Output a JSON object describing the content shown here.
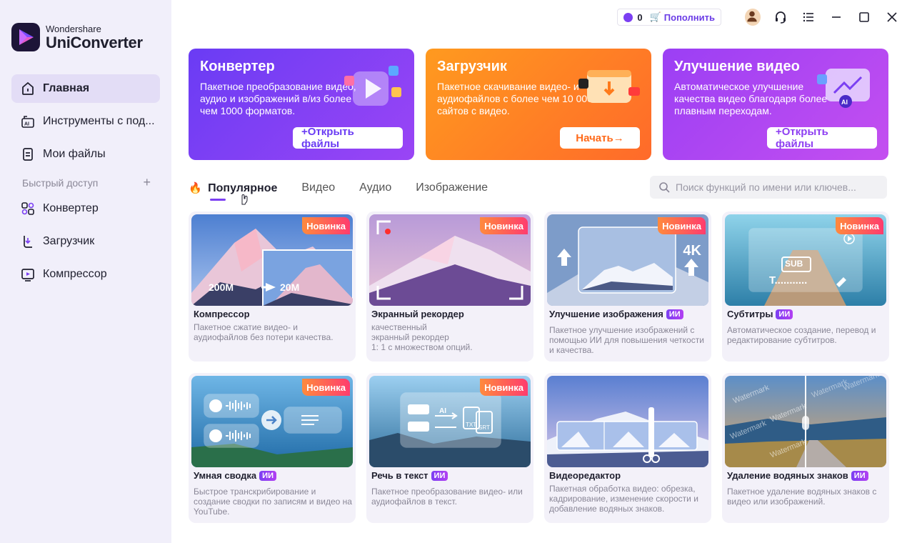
{
  "brand": {
    "company": "Wondershare",
    "product": "UniConverter"
  },
  "sidebar": {
    "items": [
      {
        "label": "Главная",
        "icon": "home-icon"
      },
      {
        "label": "Инструменты с под...",
        "icon": "ai-tools-icon"
      },
      {
        "label": "Мои файлы",
        "icon": "files-icon"
      }
    ],
    "quick_access_label": "Быстрый доступ",
    "quick_add": "+",
    "quick_items": [
      {
        "label": "Конвертер",
        "icon": "converter-icon"
      },
      {
        "label": "Загрузчик",
        "icon": "downloader-icon"
      },
      {
        "label": "Компрессор",
        "icon": "compressor-icon"
      }
    ]
  },
  "topbar": {
    "credits": "0",
    "topup_label": "Пополнить"
  },
  "banners": [
    {
      "title": "Конвертер",
      "desc": "Пакетное преобразование видео, аудио и изображений в/из более чем 1000 форматов.",
      "button": "+Открыть файлы",
      "color": "#7a3ff0"
    },
    {
      "title": "Загрузчик",
      "desc": "Пакетное скачивание видео- и аудиофайлов с более чем 10 000 сайтов с видео.",
      "button": "Начать→",
      "color": "#ff8a1f"
    },
    {
      "title": "Улучшение видео",
      "desc": "Автоматическое улучшение качества видео благодаря более плавным переходам.",
      "button": "+Открыть файлы",
      "color": "#a63ff0"
    }
  ],
  "tabs": {
    "popular": "Популярное",
    "video": "Видео",
    "audio": "Аудио",
    "image": "Изображение",
    "fire": "🔥"
  },
  "search": {
    "placeholder": "Поиск функций по имени или ключев..."
  },
  "badge_new": "Новинка",
  "ai_tag": "ИИ",
  "cards": [
    {
      "title": "Компрессор",
      "desc": "Пакетное сжатие видео- и аудиофайлов без потери качества.",
      "from": "200M",
      "to": "20M"
    },
    {
      "title": "Экранный рекордер",
      "desc": "качественный\nэкранный рекордер\n1: 1 с множеством опций."
    },
    {
      "title": "Улучшение изображения",
      "desc": "Пакетное улучшение изображений с помощью ИИ для повышения четкости и качества.",
      "res": "4K"
    },
    {
      "title": "Субтитры",
      "desc": "Автоматическое создание, перевод и редактирование субтитров.",
      "sub": "SUB",
      "t": "T..........."
    },
    {
      "title": "Умная сводка",
      "desc": "Быстрое транскрибирование и создание сводки по записям и видео на YouTube."
    },
    {
      "title": "Речь в текст",
      "desc": "Пакетное преобразование видео- или аудиофайлов в текст.",
      "ai": "AI",
      "txt": "TXT",
      "srt": "SRT"
    },
    {
      "title": "Видеоредактор",
      "desc": "Пакетная обработка видео: обрезка, кадрирование, изменение скорости и добавление водяных знаков."
    },
    {
      "title": "Удаление водяных знаков",
      "desc": "Пакетное удаление водяных знаков с видео или изображений.",
      "wm": "Watermark"
    }
  ]
}
